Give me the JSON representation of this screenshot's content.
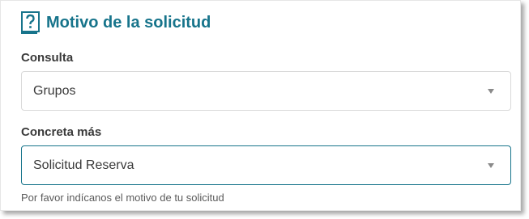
{
  "header": {
    "icon": "question-book-icon",
    "title": "Motivo de la solicitud",
    "accent_color": "#17748b"
  },
  "fields": [
    {
      "label": "Consulta",
      "value": "Grupos"
    },
    {
      "label": "Concreta más",
      "value": "Solicitud Reserva",
      "help": "Por favor indícanos el motivo de tu solicitud"
    }
  ]
}
